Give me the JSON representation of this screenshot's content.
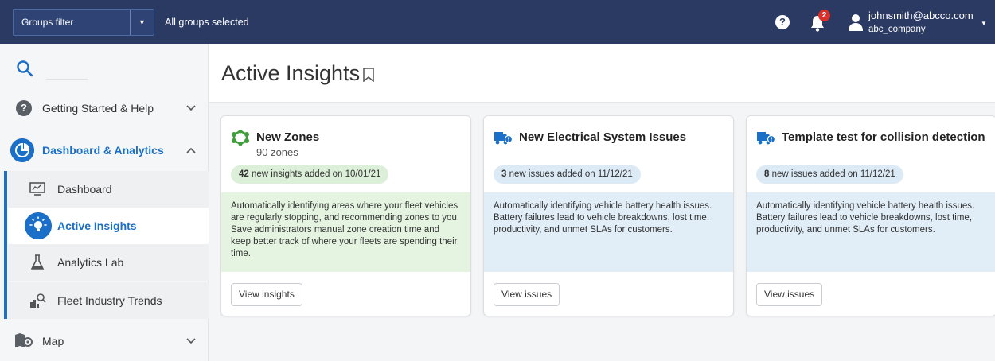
{
  "topbar": {
    "groups_filter_label": "Groups filter",
    "groups_status": "All groups selected",
    "notification_count": "2",
    "help_glyph": "?",
    "user_email": "johnsmith@abcco.com",
    "user_company": "abc_company"
  },
  "sidebar": {
    "sections": [
      {
        "label": "Getting Started & Help",
        "icon": "help-icon"
      },
      {
        "label": "Dashboard & Analytics",
        "icon": "dashboard-analytics-icon",
        "expanded": true
      },
      {
        "label": "Map",
        "icon": "map-icon"
      }
    ],
    "subitems": [
      {
        "label": "Dashboard",
        "icon": "dashboard-icon"
      },
      {
        "label": "Active Insights",
        "icon": "lightbulb-icon",
        "active": true
      },
      {
        "label": "Analytics Lab",
        "icon": "flask-icon"
      },
      {
        "label": "Fleet Industry Trends",
        "icon": "trends-icon"
      }
    ]
  },
  "main": {
    "title": "Active Insights",
    "cards": [
      {
        "title": "New Zones",
        "subtitle": "90 zones",
        "pill_count": "42",
        "pill_text": "new insights added on 10/01/21",
        "body": "Automatically identifying areas where your fleet vehicles are regularly stopping, and recommending zones to you. Save administrators manual zone creation time and keep better track of where your fleets are spending their time.",
        "button": "View insights",
        "icon": "zones-icon",
        "accent": "#3f9d3a"
      },
      {
        "title": "New Electrical System Issues",
        "subtitle": "",
        "pill_count": "3",
        "pill_text": "new issues added on 11/12/21",
        "body": "Automatically identifying vehicle battery health issues. Battery failures lead to vehicle breakdowns, lost time, productivity, and unmet SLAs for customers.",
        "button": "View issues",
        "icon": "truck-alert-icon",
        "accent": "#1a6fc9"
      },
      {
        "title": "Template test for collision detection",
        "subtitle": "",
        "pill_count": "8",
        "pill_text": "new issues added on 11/12/21",
        "body": "Automatically identifying vehicle battery health issues. Battery failures lead to vehicle breakdowns, lost time, productivity, and unmet SLAs for customers.",
        "button": "View issues",
        "icon": "truck-alert-icon",
        "accent": "#1a6fc9"
      }
    ]
  }
}
